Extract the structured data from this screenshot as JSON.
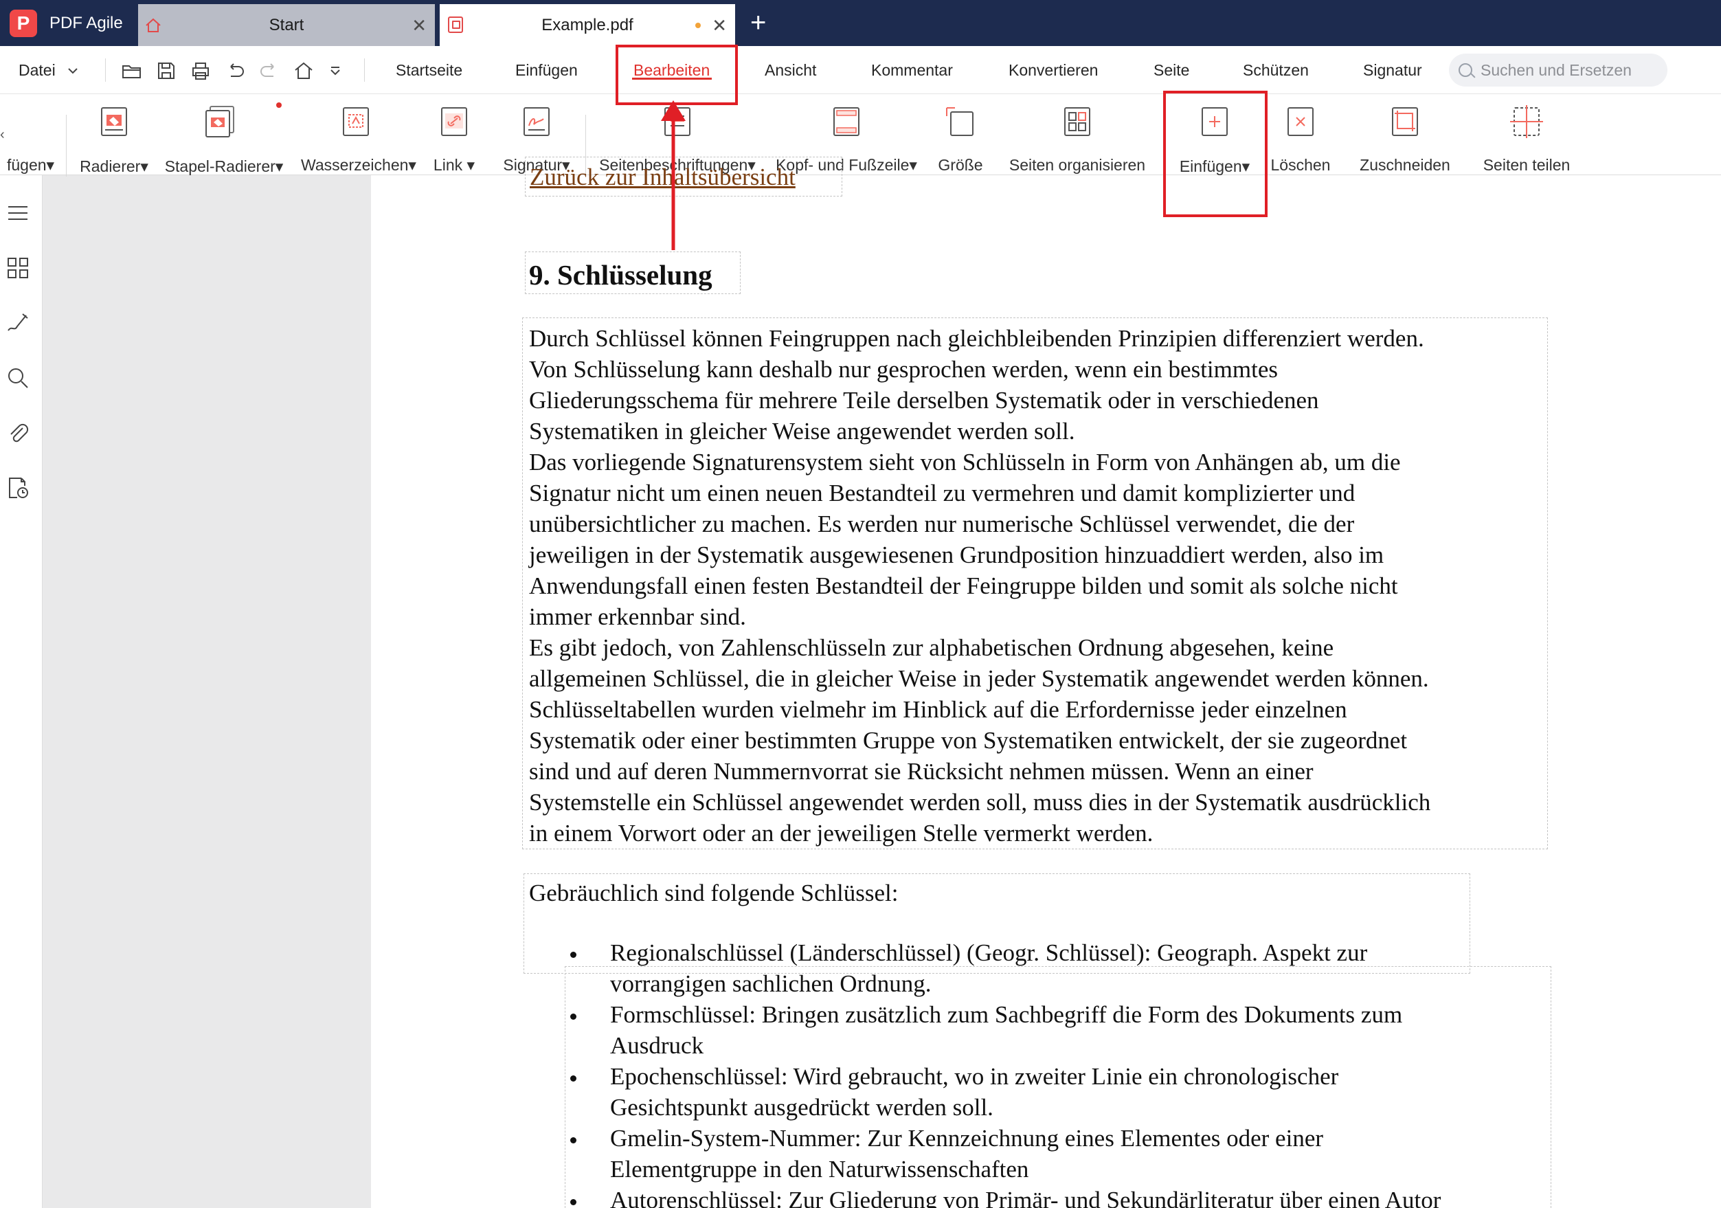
{
  "app": {
    "name": "PDF Agile",
    "logo_letter": "P"
  },
  "tabs": {
    "start_label": "Start",
    "doc_label": "Example.pdf",
    "close_glyph": "✕",
    "new_tab_glyph": "+"
  },
  "menu": {
    "datei": "Datei",
    "items": [
      "Startseite",
      "Einfügen",
      "Bearbeiten",
      "Ansicht",
      "Kommentar",
      "Konvertieren",
      "Seite",
      "Schützen",
      "Signatur"
    ],
    "active": "Bearbeiten",
    "search_placeholder": "Suchen und Ersetzen"
  },
  "ribbon": {
    "items": [
      {
        "label": "fügen▾",
        "icon": "insert-icon"
      },
      {
        "label": "Radierer▾",
        "icon": "eraser-icon"
      },
      {
        "label": "Stapel-Radierer▾",
        "icon": "batch-eraser-icon"
      },
      {
        "label": "Wasserzeichen▾",
        "icon": "watermark-icon"
      },
      {
        "label": "Link ▾",
        "icon": "link-icon"
      },
      {
        "label": "Signatur▾",
        "icon": "signature-icon"
      },
      {
        "label": "Seitenbeschriftungen▾",
        "icon": "page-labels-icon"
      },
      {
        "label": "Kopf- und Fußzeile▾",
        "icon": "header-footer-icon"
      },
      {
        "label": "Größe",
        "icon": "size-icon"
      },
      {
        "label": "Seiten organisieren",
        "icon": "organize-pages-icon"
      },
      {
        "label": "Einfügen▾",
        "icon": "insert-page-icon"
      },
      {
        "label": "Löschen",
        "icon": "delete-page-icon"
      },
      {
        "label": "Zuschneiden",
        "icon": "crop-icon"
      },
      {
        "label": "Seiten teilen",
        "icon": "split-pages-icon"
      }
    ]
  },
  "sidebar": {
    "icons": [
      "outline-icon",
      "thumbnails-icon",
      "signature-tool-icon",
      "search-icon",
      "attachment-icon",
      "page-history-icon"
    ]
  },
  "document": {
    "toc_link": "Zurück zur Inhaltsübersicht",
    "heading": "9. Schlüsselung",
    "para_lines": [
      "Durch Schlüssel können Feingruppen nach gleichbleibenden Prinzipien differenziert werden.",
      "Von Schlüsselung kann deshalb nur gesprochen werden, wenn ein bestimmtes",
      "Gliederungsschema für mehrere Teile derselben Systematik oder in verschiedenen",
      "Systematiken in gleicher Weise angewendet werden soll.",
      "Das vorliegende Signaturensystem sieht von Schlüsseln in Form von Anhängen ab, um die",
      "Signatur nicht um einen neuen Bestandteil zu vermehren und damit komplizierter und",
      "unübersichtlicher zu machen. Es werden nur numerische Schlüssel verwendet, die der",
      "jeweiligen in der Systematik ausgewiesenen Grundposition hinzuaddiert werden, also im",
      "Anwendungsfall einen festen Bestandteil der Feingruppe bilden und somit als solche nicht",
      "immer erkennbar sind.",
      "Es gibt jedoch, von Zahlenschlüsseln zur alphabetischen Ordnung abgesehen, keine",
      "allgemeinen Schlüssel, die in gleicher Weise in jeder Systematik angewendet werden können.",
      "Schlüsseltabellen wurden vielmehr im Hinblick auf die Erfordernisse jeder einzelnen",
      "Systematik oder einer bestimmten Gruppe von Systematiken entwickelt, der sie zugeordnet",
      "sind und auf deren Nummernvorrat sie Rücksicht nehmen müssen. Wenn an einer",
      "Systemstelle ein Schlüssel angewendet werden soll, muss dies in der Systematik ausdrücklich",
      "in einem Vorwort oder an der jeweiligen Stelle vermerkt werden."
    ],
    "list_intro": "Gebräuchlich sind folgende Schlüssel:",
    "bullets": [
      [
        "Regionalschlüssel (Länderschlüssel) (Geogr. Schlüssel): Geograph. Aspekt zur",
        "vorrangigen sachlichen Ordnung."
      ],
      [
        "Formschlüssel: Bringen zusätzlich zum Sachbegriff die Form des Dokuments zum",
        "Ausdruck"
      ],
      [
        "Epochenschlüssel: Wird gebraucht, wo in zweiter Linie ein chronologischer",
        "Gesichtspunkt ausgedrückt werden soll."
      ],
      [
        "Gmelin-System-Nummer: Zur Kennzeichnung eines Elementes oder einer",
        "Elementgruppe in den Naturwissenschaften"
      ],
      [
        "Autorenschlüssel: Zur Gliederung von Primär- und Sekundärliteratur über einen Autor"
      ]
    ]
  },
  "colors": {
    "titlebar": "#1d2b4f",
    "accent": "#e0322e",
    "annotation": "#e01f26"
  }
}
